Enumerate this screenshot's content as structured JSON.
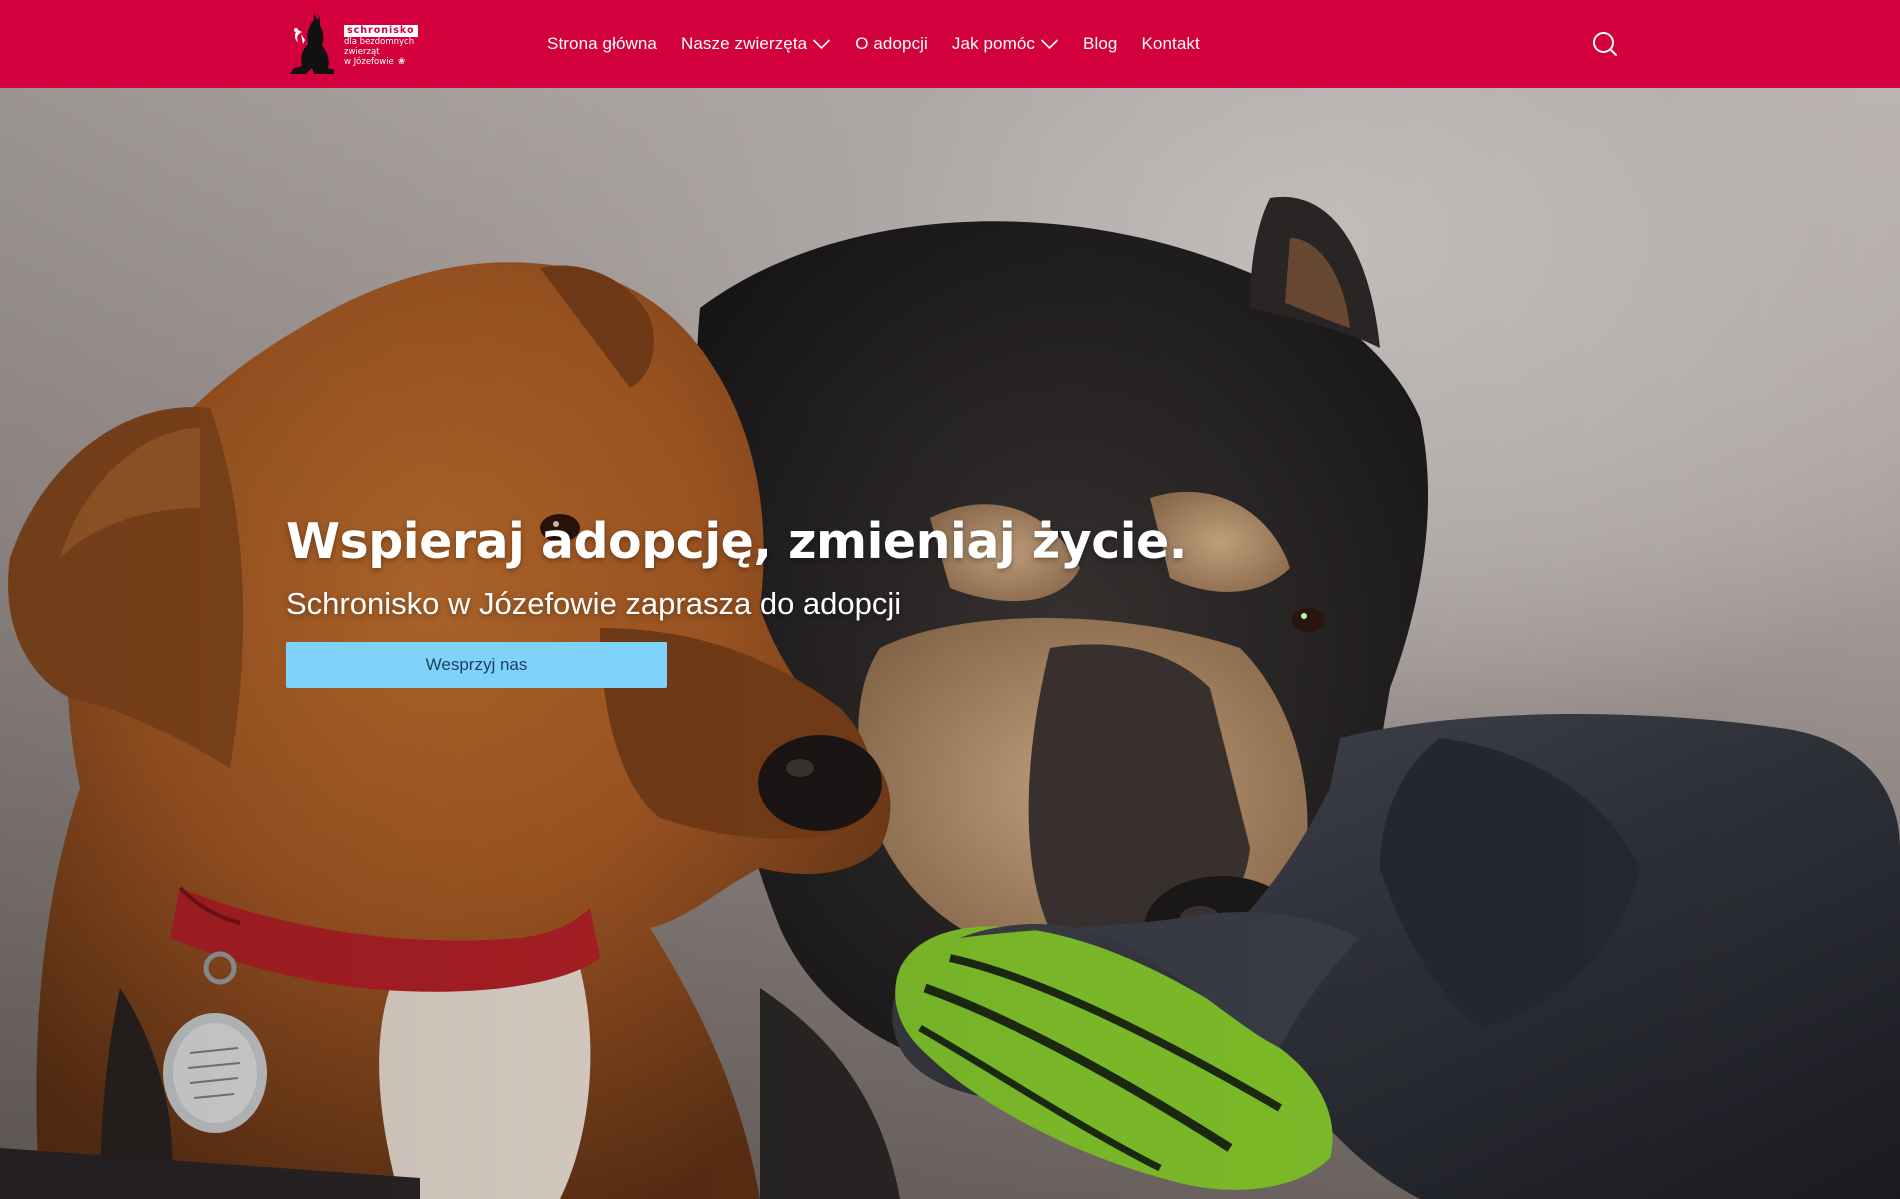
{
  "brand": {
    "badge": "schronisko",
    "line1": "dla bezdomnych",
    "line2": "zwierząt",
    "line3": "w Józefowie",
    "logo_icon": "dog-and-cat-silhouette-icon",
    "paw_icon": "paw-icon"
  },
  "nav": {
    "items": [
      {
        "label": "Strona główna",
        "has_dropdown": false
      },
      {
        "label": "Nasze zwierzęta",
        "has_dropdown": true
      },
      {
        "label": "O adopcji",
        "has_dropdown": false
      },
      {
        "label": "Jak pomóc",
        "has_dropdown": true
      },
      {
        "label": "Blog",
        "has_dropdown": false
      },
      {
        "label": "Kontakt",
        "has_dropdown": false
      }
    ],
    "search_icon": "search-icon"
  },
  "hero": {
    "title": "Wspieraj adopcję, zmieniaj życie.",
    "subtitle": "Schronisko w Józefowie zaprasza do adopcji",
    "cta_label": "Wesprzyj nas",
    "image": "two-dogs-sniffing-gloved-hand-photo"
  },
  "colors": {
    "header_bg": "#d2003c",
    "cta_bg": "#7fd3fb",
    "text_on_header": "#ffffff"
  }
}
